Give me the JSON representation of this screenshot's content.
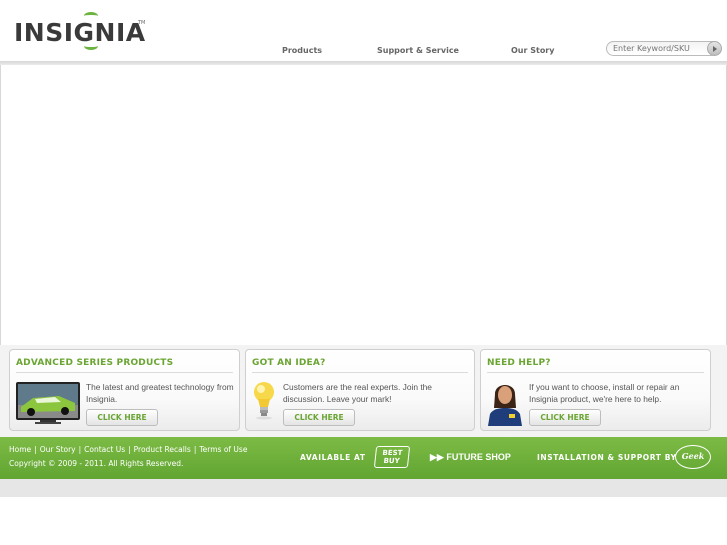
{
  "brand": {
    "name": "INSIGNIA",
    "tm": "TM"
  },
  "nav": [
    {
      "label": "Products"
    },
    {
      "label": "Support & Service"
    },
    {
      "label": "Our Story"
    }
  ],
  "search": {
    "placeholder": "Enter Keyword/SKU"
  },
  "panels": [
    {
      "title": "ADVANCED SERIES PRODUCTS",
      "text": "The latest and greatest technology from Insignia.",
      "button": "CLICK HERE"
    },
    {
      "title": "GOT AN IDEA?",
      "text": "Customers are the real experts. Join the discussion. Leave your mark!",
      "button": "CLICK HERE"
    },
    {
      "title": "NEED HELP?",
      "text": "If you want to choose, install or repair an Insignia product, we're here to help.",
      "button": "CLICK HERE"
    }
  ],
  "footer": {
    "links": [
      "Home",
      "Our Story",
      "Contact Us",
      "Product Recalls",
      "Terms of Use"
    ],
    "separator": "|",
    "copyright": "Copyright © 2009 - 2011. All Rights Reserved.",
    "available_at": "AVAILABLE AT",
    "bestbuy": "BEST BUY",
    "futureshop": "FUTURE SHOP",
    "futureshop_arrows": "▶▶",
    "install_support": "INSTALLATION & SUPPORT BY",
    "geeksquad": "Geek"
  },
  "colors": {
    "accent": "#6aa532",
    "footer": "#6db33f",
    "logo": "#3a3a3a"
  }
}
